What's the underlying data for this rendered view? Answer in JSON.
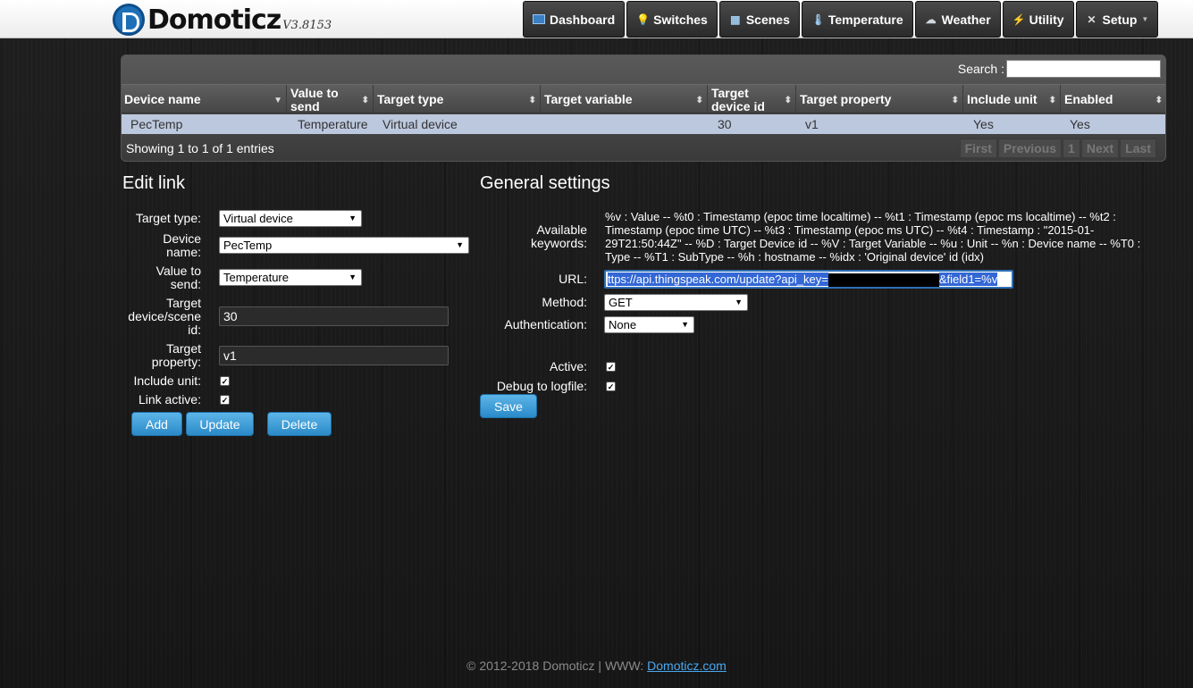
{
  "brand": {
    "name": "Domoticz",
    "version": "V3.8153"
  },
  "nav": [
    {
      "label": "Dashboard",
      "icon": "dashboard-icon"
    },
    {
      "label": "Switches",
      "icon": "lightbulb-icon"
    },
    {
      "label": "Scenes",
      "icon": "scenes-icon"
    },
    {
      "label": "Temperature",
      "icon": "thermometer-icon"
    },
    {
      "label": "Weather",
      "icon": "weather-icon"
    },
    {
      "label": "Utility",
      "icon": "utility-icon"
    },
    {
      "label": "Setup",
      "icon": "tools-icon"
    }
  ],
  "table": {
    "search_label": "Search :",
    "search_value": "",
    "columns": [
      "Device name",
      "Value to send",
      "Target type",
      "Target variable",
      "Target device id",
      "Target property",
      "Include unit",
      "Enabled"
    ],
    "rows": [
      {
        "device_name": "PecTemp",
        "value_to_send": "Temperature",
        "target_type": "Virtual device",
        "target_variable": "",
        "target_device_id": "30",
        "target_property": "v1",
        "include_unit": "Yes",
        "enabled": "Yes"
      }
    ],
    "info": "Showing 1 to 1 of 1 entries",
    "pager": [
      "First",
      "Previous",
      "1",
      "Next",
      "Last"
    ]
  },
  "edit_link": {
    "title": "Edit link",
    "target_type_label": "Target type:",
    "target_type_value": "Virtual device",
    "device_name_label": "Device name:",
    "device_name_value": "PecTemp",
    "value_to_send_label": "Value to send:",
    "value_to_send_value": "Temperature",
    "target_id_label": "Target device/scene id:",
    "target_id_value": "30",
    "target_property_label": "Target property:",
    "target_property_value": "v1",
    "include_unit_label": "Include unit:",
    "link_active_label": "Link active:",
    "add_label": "Add",
    "update_label": "Update",
    "delete_label": "Delete"
  },
  "general": {
    "title": "General settings",
    "keywords_label": "Available keywords:",
    "keywords_text": "%v : Value -- %t0 : Timestamp (epoc time localtime) -- %t1 : Timestamp (epoc ms localtime) -- %t2 : Timestamp (epoc time UTC) -- %t3 : Timestamp (epoc ms UTC) -- %t4 : Timestamp : \"2015-01-29T21:50:44Z\" -- %D : Target Device id -- %V : Target Variable -- %u : Unit -- %n : Device name -- %T0 : Type -- %T1 : SubType -- %h : hostname -- %idx : 'Original device' id (idx)",
    "url_label": "URL:",
    "url_part1": "ttps://api.thingspeak.com/update?api_key=",
    "url_part2": "&field1=%v",
    "method_label": "Method:",
    "method_value": "GET",
    "auth_label": "Authentication:",
    "auth_value": "None",
    "active_label": "Active:",
    "debug_label": "Debug to logfile:",
    "save_label": "Save"
  },
  "footer": {
    "text": "© 2012-2018 Domoticz | WWW:",
    "link": "Domoticz.com"
  },
  "colors": {
    "accent": "#2a8ac8",
    "row_selected": "#bcc8de"
  }
}
